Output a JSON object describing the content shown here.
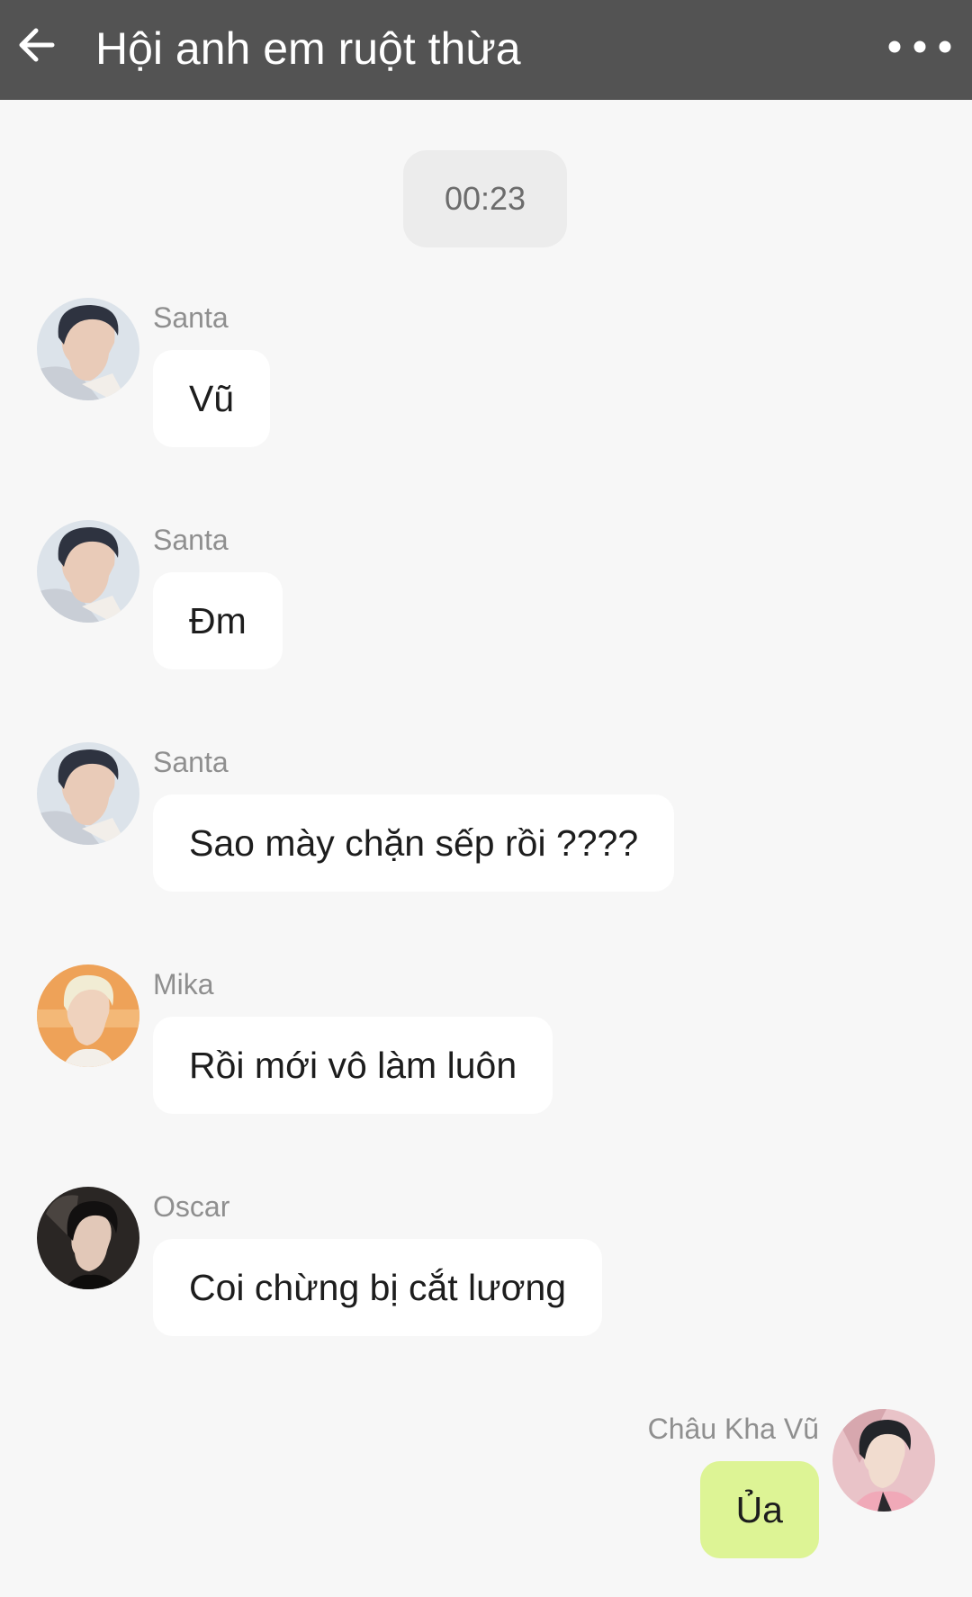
{
  "header": {
    "title": "Hội anh em ruột thừa",
    "back_icon": "arrow-left-icon",
    "more_icon": "more-horizontal-icon",
    "background": "#535353"
  },
  "timestamp": "00:23",
  "messages": [
    {
      "sender": "Santa",
      "text": "Vũ",
      "mine": false
    },
    {
      "sender": "Santa",
      "text": "Đm",
      "mine": false
    },
    {
      "sender": "Santa",
      "text": "Sao mày chặn sếp rồi ????",
      "mine": false
    },
    {
      "sender": "Mika",
      "text": "Rồi mới vô làm luôn",
      "mine": false
    },
    {
      "sender": "Oscar",
      "text": "Coi chừng bị cắt lương",
      "mine": false
    },
    {
      "sender": "Châu Kha Vũ",
      "text": "Ủa",
      "mine": true
    }
  ],
  "colors": {
    "incoming_bubble": "#ffffff",
    "outgoing_bubble": "#ddf495",
    "chat_background": "#f7f7f7"
  }
}
